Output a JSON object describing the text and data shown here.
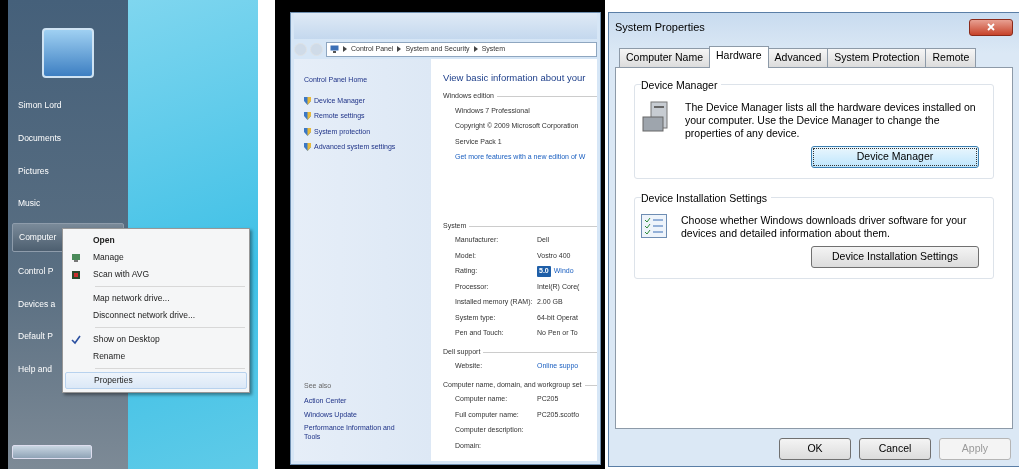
{
  "start_menu": {
    "user_name": "Simon Lord",
    "items": [
      {
        "label": "Documents",
        "selected": false
      },
      {
        "label": "Pictures",
        "selected": false
      },
      {
        "label": "Music",
        "selected": false
      },
      {
        "label": "Computer",
        "selected": true
      },
      {
        "label": "Control P",
        "selected": false
      },
      {
        "label": "Devices a",
        "selected": false
      },
      {
        "label": "Default P",
        "selected": false
      },
      {
        "label": "Help and",
        "selected": false
      }
    ]
  },
  "context_menu": {
    "items": [
      {
        "kind": "default",
        "label": "Open",
        "checked": false,
        "selected": false
      },
      {
        "kind": "iconic",
        "label": "Manage",
        "checked": false,
        "selected": false
      },
      {
        "kind": "antivirus",
        "label": "Scan with AVG",
        "checked": false,
        "selected": false
      },
      {
        "kind": "separator"
      },
      {
        "kind": "plain",
        "label": "Map network drive...",
        "checked": false,
        "selected": false
      },
      {
        "kind": "plain",
        "label": "Disconnect network drive...",
        "checked": false,
        "selected": false
      },
      {
        "kind": "separator"
      },
      {
        "kind": "plain",
        "label": "Show on Desktop",
        "checked": true,
        "selected": false
      },
      {
        "kind": "plain",
        "label": "Rename",
        "checked": false,
        "selected": false
      },
      {
        "kind": "separator"
      },
      {
        "kind": "plain",
        "label": "Properties",
        "checked": false,
        "selected": true
      }
    ]
  },
  "explorer": {
    "breadcrumb": [
      "Control Panel",
      "System and Security",
      "System"
    ],
    "sidebar": {
      "home": "Control Panel Home",
      "tasks": [
        "Device Manager",
        "Remote settings",
        "System protection",
        "Advanced system settings"
      ],
      "see_also_heading": "See also",
      "see_also": [
        "Action Center",
        "Windows Update",
        "Performance Information and Tools"
      ]
    },
    "heading": "View basic information about your",
    "sections": [
      {
        "title": "Windows edition",
        "rows": [
          {
            "kind": "text",
            "text": "Windows 7 Professional"
          },
          {
            "kind": "text",
            "text": "Copyright © 2009 Microsoft Corporation"
          },
          {
            "kind": "text",
            "text": "Service Pack 1"
          },
          {
            "kind": "link",
            "text": "Get more features with a new edition of W"
          }
        ]
      },
      {
        "title": "System",
        "rows": [
          {
            "kind": "pair",
            "label": "Manufacturer:",
            "value": "Dell"
          },
          {
            "kind": "pair",
            "label": "Model:",
            "value": "Vostro 400"
          },
          {
            "kind": "rating",
            "label": "Rating:",
            "score": "5.0",
            "value": "Windo"
          },
          {
            "kind": "pair",
            "label": "Processor:",
            "value": "Intel(R) Core("
          },
          {
            "kind": "pair",
            "label": "Installed memory (RAM):",
            "value": "2.00 GB"
          },
          {
            "kind": "pair",
            "label": "System type:",
            "value": "64-bit Operat"
          },
          {
            "kind": "pair",
            "label": "Pen and Touch:",
            "value": "No Pen or To"
          }
        ]
      },
      {
        "title": "Dell support",
        "rows": [
          {
            "kind": "linkpair",
            "label": "Website:",
            "value": "Online suppo"
          }
        ]
      },
      {
        "title": "Computer name, domain, and workgroup set",
        "rows": [
          {
            "kind": "pair",
            "label": "Computer name:",
            "value": "PC205"
          },
          {
            "kind": "pair",
            "label": "Full computer name:",
            "value": "PC205.scotfo"
          },
          {
            "kind": "pair",
            "label": "Computer description:"
          },
          {
            "kind": "pair",
            "label": "Domain:"
          }
        ]
      }
    ]
  },
  "dialog": {
    "title": "System Properties",
    "tabs": [
      {
        "label": "Computer Name",
        "selected": false
      },
      {
        "label": "Hardware",
        "selected": true
      },
      {
        "label": "Advanced",
        "selected": false
      },
      {
        "label": "System Protection",
        "selected": false
      },
      {
        "label": "Remote",
        "selected": false
      }
    ],
    "groups": [
      {
        "kind": "device",
        "title": "Device Manager",
        "text": "The Device Manager lists all the hardware devices installed on your computer. Use the Device Manager to change the properties of any device.",
        "button": "Device Manager",
        "focused": true
      },
      {
        "kind": "checklist",
        "title": "Device Installation Settings",
        "text": "Choose whether Windows downloads driver software for your devices and detailed information about them.",
        "button": "Device Installation Settings",
        "focused": false
      }
    ],
    "buttons": [
      {
        "label": "OK",
        "disabled": false
      },
      {
        "label": "Cancel",
        "disabled": false
      },
      {
        "label": "Apply",
        "disabled": true
      }
    ]
  }
}
